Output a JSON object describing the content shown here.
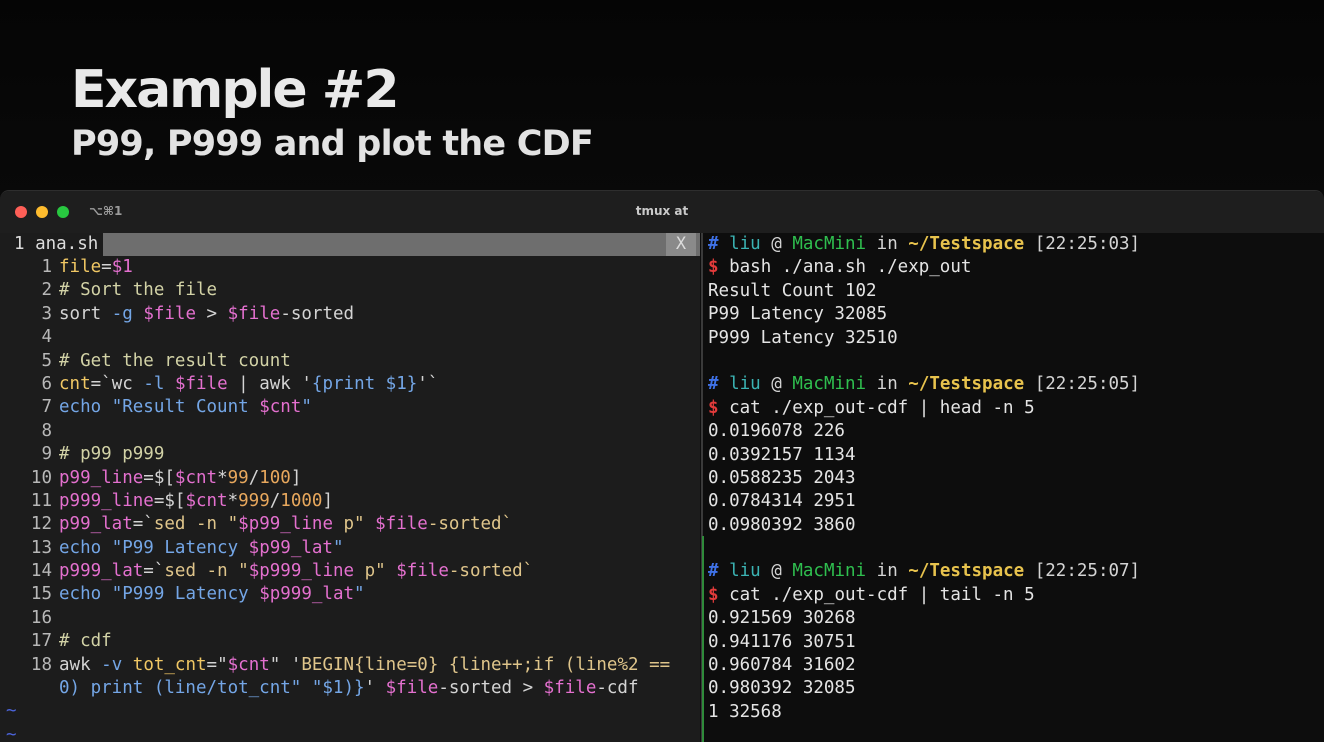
{
  "slide": {
    "title": "Example #2",
    "subtitle": "P99, P999 and plot the CDF"
  },
  "window": {
    "shortcut": "⌥⌘1",
    "title": "tmux at"
  },
  "editor": {
    "tab_label": "1 ana.sh",
    "close_label": "X",
    "lines": [
      {
        "num": "1",
        "tokens": [
          {
            "t": "file",
            "c": "ident"
          },
          {
            "t": "=",
            "c": "op"
          },
          {
            "t": "$1",
            "c": "var"
          }
        ]
      },
      {
        "num": "2",
        "tokens": [
          {
            "t": "# Sort the file",
            "c": "cmt"
          }
        ]
      },
      {
        "num": "3",
        "tokens": [
          {
            "t": "sort",
            "c": "op"
          },
          {
            "t": " ",
            "c": "op"
          },
          {
            "t": "-g",
            "c": "kw"
          },
          {
            "t": " ",
            "c": "op"
          },
          {
            "t": "$file",
            "c": "var"
          },
          {
            "t": " > ",
            "c": "op"
          },
          {
            "t": "$file",
            "c": "var"
          },
          {
            "t": "-sorted",
            "c": "op"
          }
        ]
      },
      {
        "num": "4",
        "tokens": []
      },
      {
        "num": "5",
        "tokens": [
          {
            "t": "# Get the result count",
            "c": "cmt"
          }
        ]
      },
      {
        "num": "6",
        "tokens": [
          {
            "t": "cnt",
            "c": "ident"
          },
          {
            "t": "=`",
            "c": "op"
          },
          {
            "t": "wc",
            "c": "op"
          },
          {
            "t": " ",
            "c": "op"
          },
          {
            "t": "-l",
            "c": "kw"
          },
          {
            "t": " ",
            "c": "op"
          },
          {
            "t": "$file",
            "c": "var"
          },
          {
            "t": " | ",
            "c": "op"
          },
          {
            "t": "awk",
            "c": "op"
          },
          {
            "t": " '",
            "c": "op"
          },
          {
            "t": "{print $1}",
            "c": "kw"
          },
          {
            "t": "'`",
            "c": "op"
          }
        ]
      },
      {
        "num": "7",
        "tokens": [
          {
            "t": "echo",
            "c": "kw"
          },
          {
            "t": " \"Result Count ",
            "c": "kw"
          },
          {
            "t": "$cnt",
            "c": "var"
          },
          {
            "t": "\"",
            "c": "kw"
          }
        ]
      },
      {
        "num": "8",
        "tokens": []
      },
      {
        "num": "9",
        "tokens": [
          {
            "t": "# p99 p999",
            "c": "cmt"
          }
        ]
      },
      {
        "num": "10",
        "tokens": [
          {
            "t": "p99_line",
            "c": "var"
          },
          {
            "t": "=$[",
            "c": "op"
          },
          {
            "t": "$cnt",
            "c": "var"
          },
          {
            "t": "*",
            "c": "op"
          },
          {
            "t": "99",
            "c": "num"
          },
          {
            "t": "/",
            "c": "op"
          },
          {
            "t": "100",
            "c": "num"
          },
          {
            "t": "]",
            "c": "op"
          }
        ]
      },
      {
        "num": "11",
        "tokens": [
          {
            "t": "p999_line",
            "c": "var"
          },
          {
            "t": "=$[",
            "c": "op"
          },
          {
            "t": "$cnt",
            "c": "var"
          },
          {
            "t": "*",
            "c": "op"
          },
          {
            "t": "999",
            "c": "num"
          },
          {
            "t": "/",
            "c": "op"
          },
          {
            "t": "1000",
            "c": "num"
          },
          {
            "t": "]",
            "c": "op"
          }
        ]
      },
      {
        "num": "12",
        "tokens": [
          {
            "t": "p99_lat",
            "c": "var"
          },
          {
            "t": "=`",
            "c": "op"
          },
          {
            "t": "sed",
            "c": "str"
          },
          {
            "t": " ",
            "c": "op"
          },
          {
            "t": "-n",
            "c": "str"
          },
          {
            "t": " \"",
            "c": "str"
          },
          {
            "t": "$p99_line",
            "c": "var"
          },
          {
            "t": " p\" ",
            "c": "str"
          },
          {
            "t": "$file",
            "c": "var"
          },
          {
            "t": "-sorted`",
            "c": "str"
          }
        ]
      },
      {
        "num": "13",
        "tokens": [
          {
            "t": "echo",
            "c": "kw"
          },
          {
            "t": " \"P99 Latency ",
            "c": "kw"
          },
          {
            "t": "$p99_lat",
            "c": "var"
          },
          {
            "t": "\"",
            "c": "kw"
          }
        ]
      },
      {
        "num": "14",
        "tokens": [
          {
            "t": "p999_lat",
            "c": "var"
          },
          {
            "t": "=`",
            "c": "op"
          },
          {
            "t": "sed",
            "c": "str"
          },
          {
            "t": " ",
            "c": "op"
          },
          {
            "t": "-n",
            "c": "str"
          },
          {
            "t": " \"",
            "c": "str"
          },
          {
            "t": "$p999_line",
            "c": "var"
          },
          {
            "t": " p\" ",
            "c": "str"
          },
          {
            "t": "$file",
            "c": "var"
          },
          {
            "t": "-sorted`",
            "c": "str"
          }
        ]
      },
      {
        "num": "15",
        "tokens": [
          {
            "t": "echo",
            "c": "kw"
          },
          {
            "t": " \"P999 Latency ",
            "c": "kw"
          },
          {
            "t": "$p999_lat",
            "c": "var"
          },
          {
            "t": "\"",
            "c": "kw"
          }
        ]
      },
      {
        "num": "16",
        "tokens": []
      },
      {
        "num": "17",
        "tokens": [
          {
            "t": "# cdf",
            "c": "cmt"
          }
        ]
      },
      {
        "num": "18",
        "tokens": [
          {
            "t": "awk",
            "c": "op"
          },
          {
            "t": " ",
            "c": "op"
          },
          {
            "t": "-v",
            "c": "kw"
          },
          {
            "t": " ",
            "c": "op"
          },
          {
            "t": "tot_cnt",
            "c": "ident"
          },
          {
            "t": "=\"",
            "c": "op"
          },
          {
            "t": "$cnt",
            "c": "var"
          },
          {
            "t": "\" '",
            "c": "op"
          },
          {
            "t": "BEGIN{line=0} {line++;if (line%2 ==",
            "c": "str"
          }
        ]
      },
      {
        "num": "",
        "tokens": [
          {
            "t": "0) print (line/tot_cnt\" \"$1)}",
            "c": "kw"
          },
          {
            "t": "' ",
            "c": "op"
          },
          {
            "t": "$file",
            "c": "var"
          },
          {
            "t": "-sorted > ",
            "c": "op"
          },
          {
            "t": "$file",
            "c": "var"
          },
          {
            "t": "-cdf",
            "c": "op"
          }
        ]
      }
    ],
    "tildes": [
      "~",
      "~"
    ]
  },
  "terminal": {
    "blocks": [
      {
        "prompt": {
          "hash": "#",
          "user": "liu",
          "at": "@",
          "host": "MacMini",
          "in": "in",
          "path": "~/Testspace",
          "time": "[22:25:03]"
        },
        "dollar": "$",
        "command": "bash ./ana.sh ./exp_out",
        "output": [
          "Result Count 102",
          "P99 Latency 32085",
          "P999 Latency 32510"
        ]
      },
      {
        "prompt": {
          "hash": "#",
          "user": "liu",
          "at": "@",
          "host": "MacMini",
          "in": "in",
          "path": "~/Testspace",
          "time": "[22:25:05]"
        },
        "dollar": "$",
        "command": "cat ./exp_out-cdf | head -n 5",
        "output": [
          "0.0196078 226",
          "0.0392157 1134",
          "0.0588235 2043",
          "0.0784314 2951",
          "0.0980392 3860"
        ]
      },
      {
        "prompt": {
          "hash": "#",
          "user": "liu",
          "at": "@",
          "host": "MacMini",
          "in": "in",
          "path": "~/Testspace",
          "time": "[22:25:07]"
        },
        "dollar": "$",
        "command": "cat ./exp_out-cdf | tail -n 5",
        "output": [
          "0.921569 30268",
          "0.941176 30751",
          "0.960784 31602",
          "0.980392 32085",
          "1 32568"
        ]
      }
    ]
  }
}
